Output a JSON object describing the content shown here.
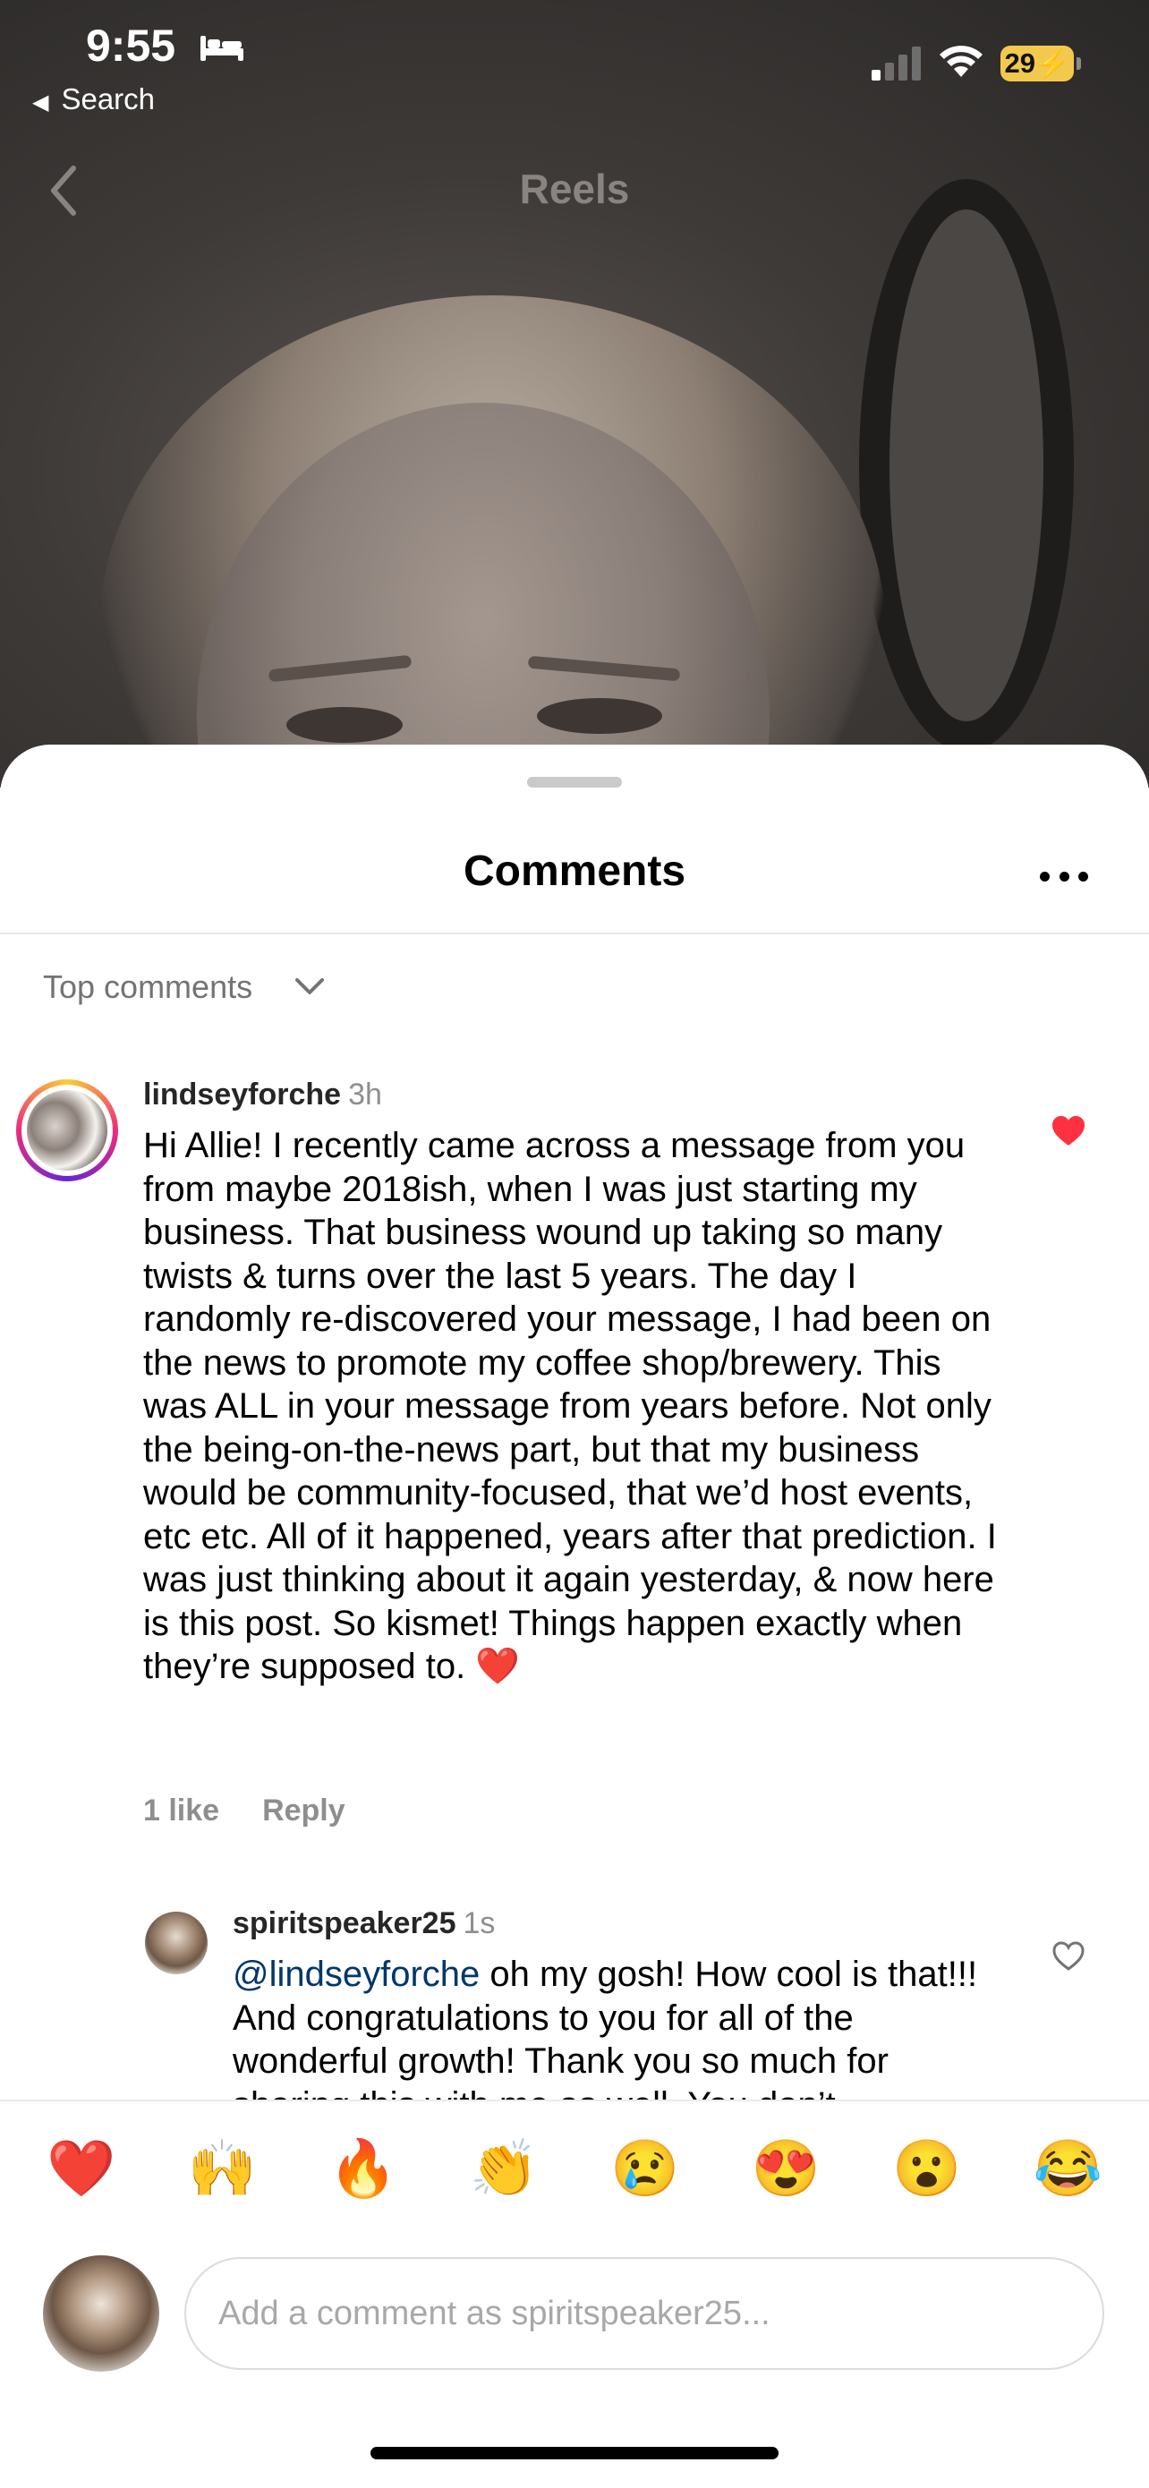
{
  "status_bar": {
    "time": "9:55",
    "back_label": "Search",
    "battery": "29"
  },
  "reels_header": {
    "title": "Reels"
  },
  "comments_sheet": {
    "title": "Comments",
    "sort_label": "Top comments",
    "comments": [
      {
        "username": "lindseyforche",
        "time": "3h",
        "text": "Hi Allie! I recently came across a message from you from maybe 2018ish, when I was just starting my business. That business wound up taking so many twists & turns over the last 5 years. The day I randomly re-discovered your message, I had been on the news to promote my coffee shop/brewery. This was ALL in your message from years before. Not only the being-on-the-news part, but that my business would be community-focused, that we’d host events, etc etc. All of it happened, years after that prediction. I was just thinking about it again yesterday, & now here is this post. So kismet! Things happen exactly when they’re supposed to. ❤️",
        "likes": "1 like",
        "reply_label": "Reply",
        "liked": true
      }
    ],
    "reply": {
      "username": "spiritspeaker25",
      "time": "1s",
      "mention": "@lindseyforche",
      "text": " oh my gosh! How cool is that!!! And congratulations to you for all of the wonderful growth! Thank you so much for sharing this with me as well. You don’t",
      "liked": false
    }
  },
  "composer": {
    "emojis": [
      "❤️",
      "🙌",
      "🔥",
      "👏",
      "😢",
      "😍",
      "😮",
      "😂"
    ],
    "placeholder": "Add a comment as spiritspeaker25..."
  },
  "colors": {
    "like_red": "#ff3040",
    "mention_blue": "#00376b",
    "battery_yellow": "#f2c94c"
  }
}
